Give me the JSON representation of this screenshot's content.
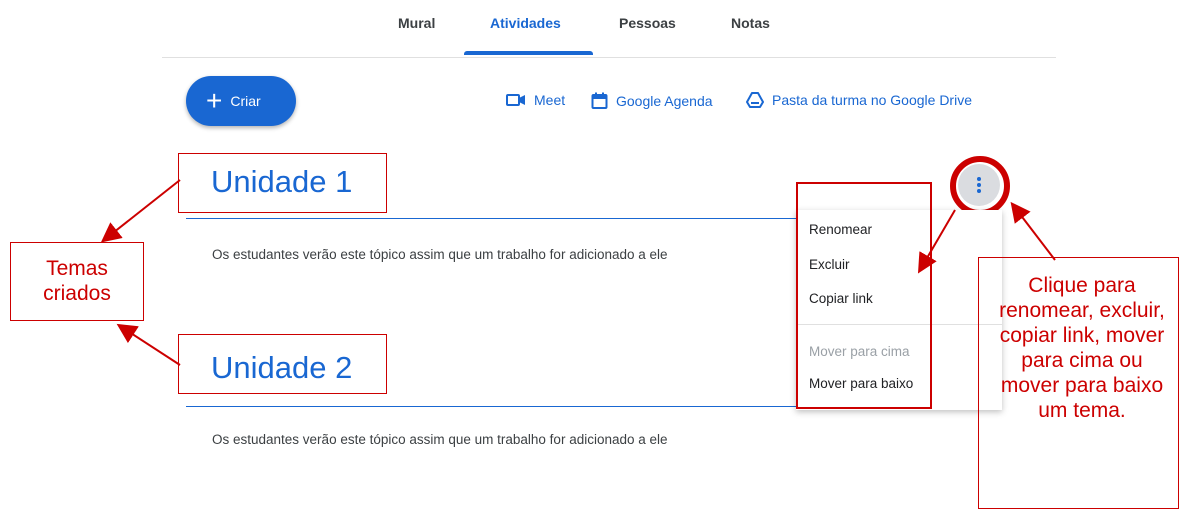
{
  "tabs": [
    {
      "label": "Mural"
    },
    {
      "label": "Atividades",
      "active": true
    },
    {
      "label": "Pessoas"
    },
    {
      "label": "Notas"
    }
  ],
  "toolbar": {
    "create_label": "Criar",
    "meet_label": "Meet",
    "calendar_label": "Google Agenda",
    "drive_label": "Pasta da turma no Google Drive"
  },
  "topics": [
    {
      "title": "Unidade 1",
      "description": "Os estudantes verão este tópico assim que um trabalho for adicionado a ele"
    },
    {
      "title": "Unidade 2",
      "description": "Os estudantes verão este tópico assim que um trabalho for adicionado a ele"
    }
  ],
  "menu": {
    "items": [
      {
        "label": "Renomear",
        "enabled": true
      },
      {
        "label": "Excluir",
        "enabled": true
      },
      {
        "label": "Copiar link",
        "enabled": true
      },
      {
        "label": "Mover para cima",
        "enabled": false
      },
      {
        "label": "Mover para baixo",
        "enabled": true
      }
    ]
  },
  "annotations": {
    "topics_label": "Temas criados",
    "menu_help": "Clique para renomear, excluir, copiar link, mover para cima ou mover para baixo um tema."
  },
  "colors": {
    "accent": "#1967d2",
    "annotation": "#cc0000"
  }
}
